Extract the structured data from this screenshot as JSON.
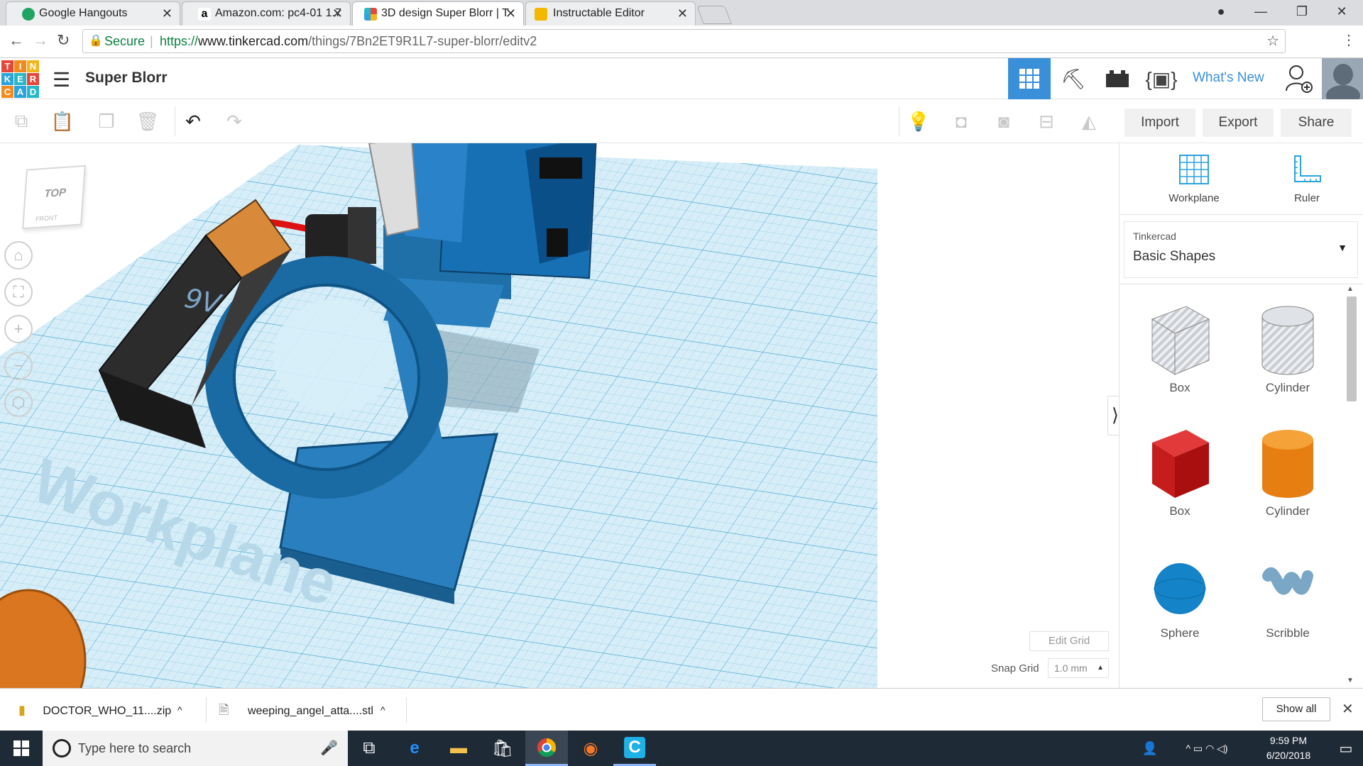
{
  "browser": {
    "tabs": [
      {
        "label": "Google Hangouts",
        "active": false
      },
      {
        "label": "Amazon.com: pc4-01 1.7",
        "active": false
      },
      {
        "label": "3D design Super Blorr | T",
        "active": true
      },
      {
        "label": "Instructable Editor",
        "active": false
      }
    ],
    "secure_label": "Secure",
    "url_scheme": "https://",
    "url_host": "www.tinkercad.com",
    "url_path": "/things/7Bn2ET9R1L7-super-blorr/editv2"
  },
  "app": {
    "logo_letters": [
      "T",
      "I",
      "N",
      "K",
      "E",
      "R",
      "C",
      "A",
      "D"
    ],
    "logo_colors": [
      "#e5473b",
      "#f28a1e",
      "#f2b51c",
      "#2aa3de",
      "#26b8c8",
      "#e5473b",
      "#f28a1e",
      "#2aa3de",
      "#26b8c8"
    ],
    "design_title": "Super Blorr",
    "whats_new": "What's New",
    "accent": "#3a8fd9"
  },
  "toolbar": {
    "import_label": "Import",
    "export_label": "Export",
    "share_label": "Share"
  },
  "viewcube": {
    "top": "TOP",
    "front": "FRONT"
  },
  "viewport": {
    "workplane_watermark": "Workplane",
    "battery_label": "9V",
    "edit_grid_label": "Edit Grid",
    "snap_grid_label": "Snap Grid",
    "snap_grid_value": "1.0 mm"
  },
  "panel": {
    "workplane_label": "Workplane",
    "ruler_label": "Ruler",
    "library_provider": "Tinkercad",
    "library_selected": "Basic Shapes",
    "shapes": [
      {
        "name": "Box",
        "style": "hole"
      },
      {
        "name": "Cylinder",
        "style": "hole"
      },
      {
        "name": "Box",
        "style": "solid-red"
      },
      {
        "name": "Cylinder",
        "style": "solid-orange"
      },
      {
        "name": "Sphere",
        "style": "solid-blue"
      },
      {
        "name": "Scribble",
        "style": "scribble"
      }
    ]
  },
  "downloads": {
    "items": [
      {
        "name": "DOCTOR_WHO_11....zip"
      },
      {
        "name": "weeping_angel_atta....stl"
      }
    ],
    "show_all": "Show all"
  },
  "taskbar": {
    "search_placeholder": "Type here to search",
    "time": "9:59 PM",
    "date": "6/20/2018"
  }
}
